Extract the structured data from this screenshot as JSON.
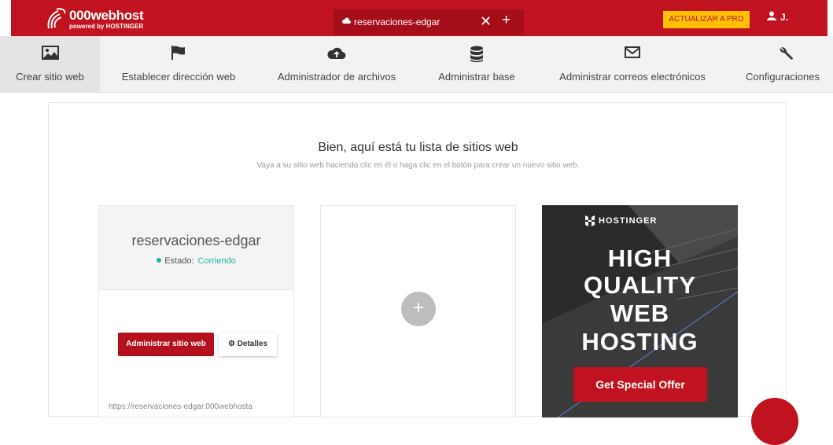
{
  "brand": {
    "name": "000webhost",
    "sub": "powered by HOSTINGER"
  },
  "site_tab": {
    "name": "reservaciones-edgar",
    "close": "✕",
    "add": "+"
  },
  "upgrade_label": "ACTUALIZAR A PRO",
  "user_label": "J.",
  "nav": [
    {
      "label": "Crear sitio web",
      "icon": "image-icon"
    },
    {
      "label": "Establecer dirección web",
      "icon": "flag-icon"
    },
    {
      "label": "Administrador de archivos",
      "icon": "cloud-upload-icon"
    },
    {
      "label": "Administrar base",
      "icon": "database-icon"
    },
    {
      "label": "Administrar correos electrónicos",
      "icon": "envelope-icon"
    },
    {
      "label": "Configuraciones",
      "icon": "wrench-icon"
    }
  ],
  "main": {
    "heading": "Bien, aquí está tu lista de sitios web",
    "subheading": "Vaya a su sitio web haciendo clic en él o haga clic en el botón para crear un nuevo sitio web."
  },
  "site_card": {
    "name": "reservaciones-edgar",
    "status_label": "Estado:",
    "status_value": "Corriendo",
    "manage_label": "Administrar sitio web",
    "details_label": "Detalles",
    "url": "https://reservaciones-edgar.000webhosta"
  },
  "add_card": {
    "plus": "+"
  },
  "ad": {
    "brand": "HOSTINGER",
    "lines": [
      "HIGH",
      "QUALITY",
      "WEB",
      "HOSTING"
    ],
    "cta": "Get Special Offer"
  },
  "colors": {
    "brand_red": "#c1121f",
    "upgrade_yellow": "#ffc107",
    "status_teal": "#1fb5a4"
  }
}
